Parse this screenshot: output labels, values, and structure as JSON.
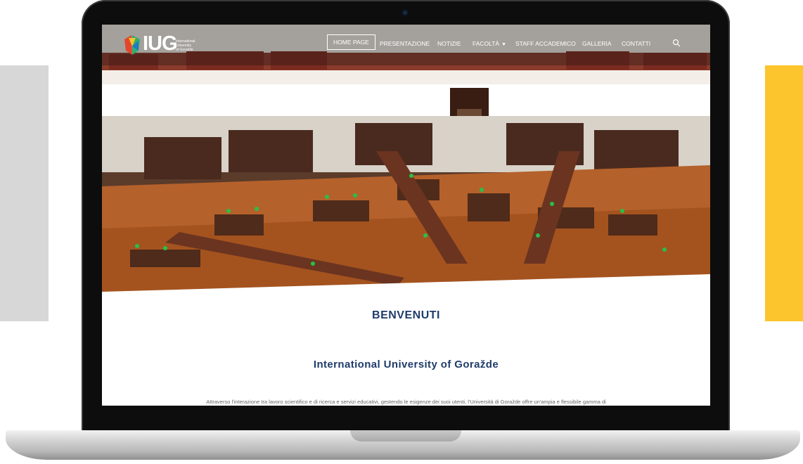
{
  "colors": {
    "left_panel": "#d7d7d7",
    "right_panel": "#fcc52e",
    "heading": "#1f3c6b",
    "nav_text": "#ffffff"
  },
  "logo": {
    "text": "IUG",
    "subtitle_line1": "International",
    "subtitle_line2": "University",
    "subtitle_line3": "of Goražde"
  },
  "nav": {
    "items": [
      {
        "label": "HOME PAGE",
        "active": true
      },
      {
        "label": "PRESENTAZIONE"
      },
      {
        "label": "NOTIZIE"
      },
      {
        "label": "FACOLTÀ",
        "dropdown": true
      },
      {
        "label": "STAFF ACCADEMICO"
      },
      {
        "label": "GALLERIA"
      },
      {
        "label": "CONTATTI"
      }
    ],
    "dropdown_caret": "▼",
    "search_icon": "search-icon"
  },
  "hero": {
    "image": "library-reading-room"
  },
  "content": {
    "welcome": "BENVENUTI",
    "subtitle": "International University of Goražde",
    "intro": "Attraverso l'interazione tra lavoro scientifico e di ricerca e servizi educativi, gestendo le esigenze dei suoi utenti, l'Università di Goražde offre un'ampia e flessibile gamma di"
  }
}
